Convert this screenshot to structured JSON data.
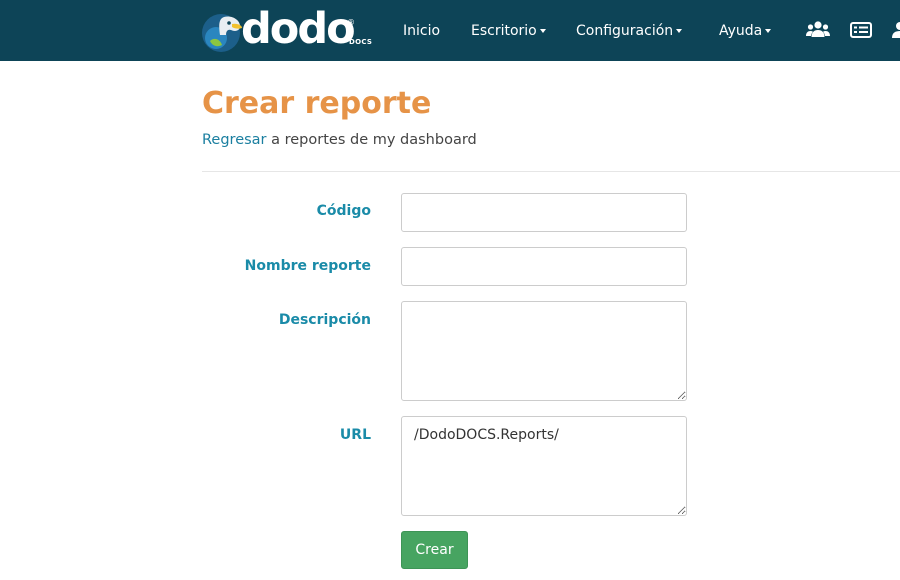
{
  "brand": {
    "wordmark": "dodo",
    "registered": "®",
    "suffix": "DOCS"
  },
  "nav": {
    "items": [
      {
        "label": "Inicio",
        "dropdown": false
      },
      {
        "label": "Escritorio",
        "dropdown": true
      },
      {
        "label": "Configuración",
        "dropdown": true
      },
      {
        "label": "Ayuda",
        "dropdown": true
      }
    ],
    "icons": [
      "users-icon",
      "list-icon",
      "user-icon"
    ]
  },
  "page": {
    "title": "Crear reporte",
    "subtitle_link": "Regresar",
    "subtitle_rest": " a reportes de my dashboard"
  },
  "form": {
    "codigo_label": "Código",
    "codigo_value": "",
    "nombre_label": "Nombre reporte",
    "nombre_value": "",
    "descripcion_label": "Descripción",
    "descripcion_value": "",
    "url_label": "URL",
    "url_value": "/DodoDOCS.Reports/",
    "submit_label": "Crear"
  },
  "colors": {
    "navbar": "#0d4457",
    "title": "#e69347",
    "label": "#1a8ba8",
    "link": "#1b7fa0",
    "button": "#47a461"
  }
}
